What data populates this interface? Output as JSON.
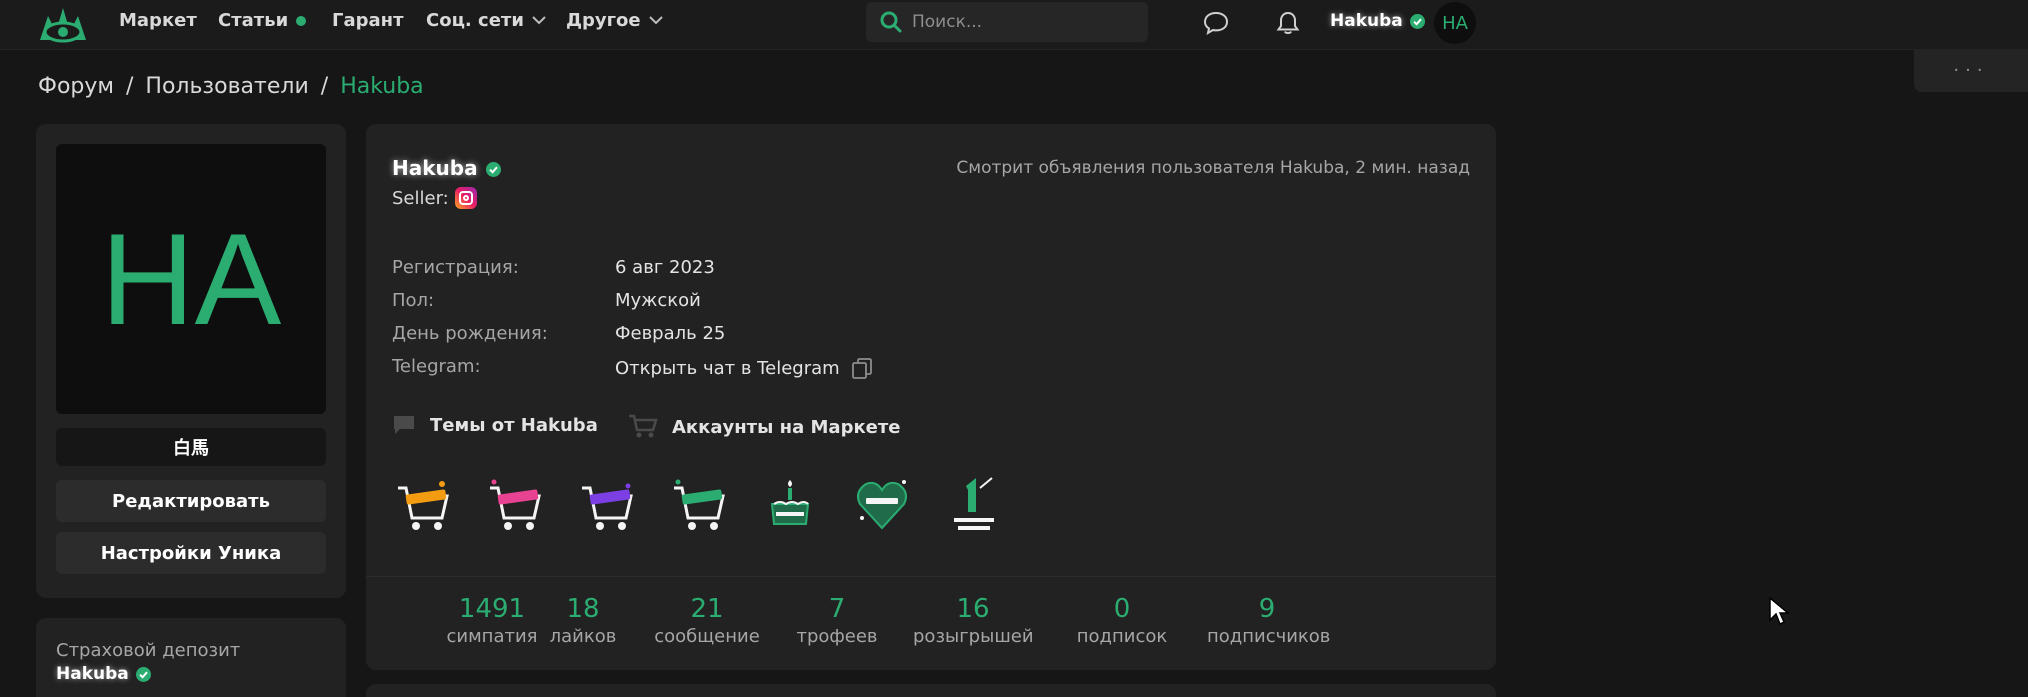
{
  "header": {
    "nav": [
      {
        "label": "Маркет"
      },
      {
        "label": "Статьи"
      },
      {
        "label": "Гарант"
      },
      {
        "label": "Соц. сети"
      },
      {
        "label": "Другое"
      }
    ],
    "search_placeholder": "Поиск...",
    "username": "Hakuba",
    "avatar_initials": "HA",
    "more_label": "···"
  },
  "breadcrumb": {
    "items": [
      "Форум",
      "Пользователи",
      "Hakuba"
    ],
    "separator": "/"
  },
  "sidebar": {
    "avatar_initials": "HA",
    "alias": "白馬",
    "edit_label": "Редактировать",
    "settings_label": "Настройки Уника",
    "deposit_title": "Страховой депозит",
    "deposit_user": "Hakuba"
  },
  "profile": {
    "name": "Hakuba",
    "status": "Смотрит объявления пользователя Hakuba, 2 мин. назад",
    "seller_label": "Seller:",
    "info": [
      {
        "label": "Регистрация:",
        "value": "6 авг 2023"
      },
      {
        "label": "Пол:",
        "value": "Мужской"
      },
      {
        "label": "День рождения:",
        "value": "Февраль 25"
      },
      {
        "label": "Telegram:",
        "value": "Открыть чат в Telegram"
      }
    ],
    "links": {
      "topics": "Темы от Hakuba",
      "market": "Аккаунты на Маркете"
    },
    "trophy_icons": [
      "cart-trophy-icon",
      "cart-trophy-icon",
      "cart-trophy-icon",
      "cart-trophy-icon",
      "birthday-trophy-icon",
      "likes-1000-trophy-icon",
      "one-year-trophy-icon"
    ],
    "stats": [
      {
        "value": "1491",
        "label": "симпатия"
      },
      {
        "value": "18",
        "label": "лайков"
      },
      {
        "value": "21",
        "label": "сообщение"
      },
      {
        "value": "7",
        "label": "трофеев"
      },
      {
        "value": "16",
        "label": "розыгрышей"
      },
      {
        "value": "0",
        "label": "подписок"
      },
      {
        "value": "9",
        "label": "подписчиков"
      }
    ]
  },
  "colors": {
    "accent": "#2bad72",
    "background": "#161616",
    "card": "#222222"
  }
}
